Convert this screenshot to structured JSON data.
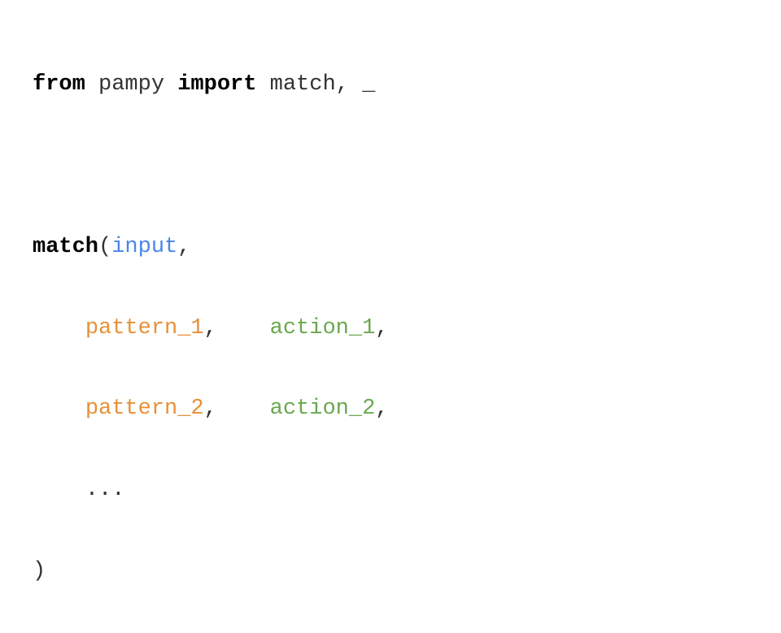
{
  "code": {
    "line1": {
      "from": "from",
      "module": " pampy ",
      "import": "import",
      "names": " match, _"
    },
    "line3": {
      "match": "match",
      "open": "(",
      "input": "input",
      "comma": ","
    },
    "line4": {
      "indent": "    ",
      "pattern": "pattern_1",
      "comma1": ",",
      "gap": "    ",
      "action": "action_1",
      "comma2": ","
    },
    "line5": {
      "indent": "    ",
      "pattern": "pattern_2",
      "comma1": ",",
      "gap": "    ",
      "action": "action_2",
      "comma2": ","
    },
    "line6": {
      "indent": "    ",
      "dots": "..."
    },
    "line7": {
      "close": ")"
    }
  }
}
